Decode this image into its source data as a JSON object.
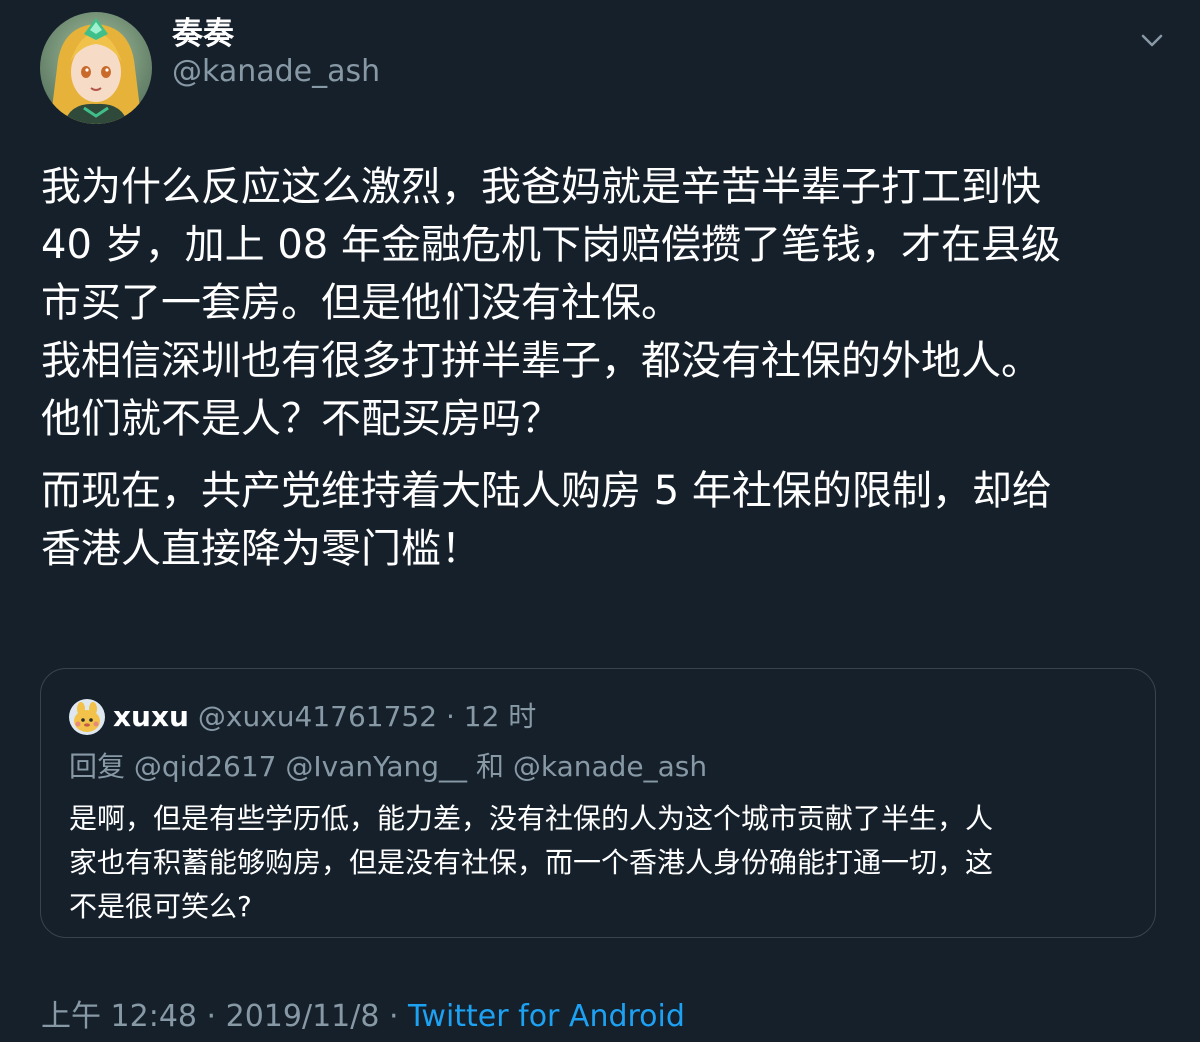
{
  "author": {
    "display_name": "奏奏",
    "handle": "@kanade_ash",
    "avatar_icon": "anime-character-avatar"
  },
  "menu_icon": "chevron-down-icon",
  "tweet": {
    "paragraphs": [
      [
        "我为什么反应这么激烈，我爸妈就是辛苦半辈子打工到快",
        "40 岁，加上 08 年金融危机下岗赔偿攒了笔钱，才在县级",
        "市买了一套房。但是他们没有社保。",
        "我相信深圳也有很多打拼半辈子，都没有社保的外地人。",
        "他们就不是人？不配买房吗？"
      ],
      [
        "而现在，共产党维持着大陆人购房 5 年社保的限制，却给",
        "香港人直接降为零门槛！"
      ]
    ]
  },
  "quoted": {
    "name": "xuxu",
    "handle": "@xuxu41761752",
    "separator": " · ",
    "time": "12 时",
    "reply_to": "回复 @qid2617 @IvanYang__ 和 @kanade_ash",
    "lines": [
      "是啊，但是有些学历低，能力差，没有社保的人为这个城市贡献了半生，人",
      "家也有积蓄能够购房，但是没有社保，而一个香港人身份确能打通一切，这",
      "不是很可笑么?"
    ]
  },
  "meta": {
    "time": "上午 12:48",
    "separator": " · ",
    "date": "2019/11/8",
    "source": "Twitter for Android"
  },
  "colors": {
    "background": "#15202b",
    "text": "#ffffff",
    "secondary": "#8899a6",
    "accent": "#1da1f2",
    "border": "#38444d"
  }
}
